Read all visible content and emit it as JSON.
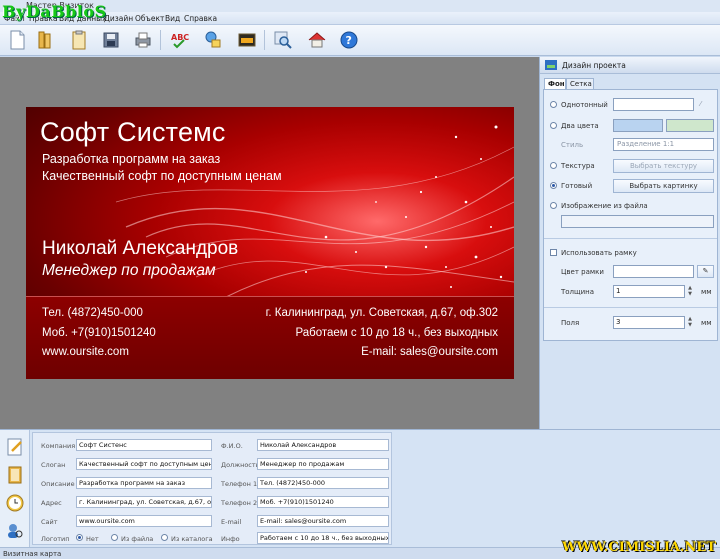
{
  "window": {
    "title": "Мастер Визиток",
    "watermark_top": "ByDaBbloS",
    "watermark_bottom": "WWW.CIMISLIA.NET"
  },
  "menu": [
    "Файл",
    "Правка",
    "Вид данных",
    "Дизайн",
    "Объект",
    "Вид",
    "Справка"
  ],
  "toolbar": {
    "icons": [
      "new-document-icon",
      "open-folder-icon",
      "clipboard-icon",
      "save-disk-icon",
      "print-icon",
      "spellcheck-icon",
      "shapes-icon",
      "image-icon",
      "zoom-icon",
      "home-icon",
      "help-icon"
    ]
  },
  "card": {
    "company": "Софт Системс",
    "slogan": "Разработка программ на заказ",
    "description": "Качественный софт по доступным ценам",
    "name": "Николай Александров",
    "position": "Менеджер по продажам",
    "phone1": "Тел. (4872)450-000",
    "phone2": "Моб. +7(910)1501240",
    "site": "www.oursite.com",
    "address": "г. Калининград, ул. Советская, д.67, оф.302",
    "hours": "Работаем с 10 до 18 ч., без выходных",
    "email": "E-mail: sales@oursite.com",
    "colors": {
      "bright": "#d80e0e",
      "dark": "#6a0000"
    }
  },
  "design_panel": {
    "title": "Дизайн проекта",
    "tabs": [
      "Фон",
      "Сетка"
    ],
    "solid_label": "Однотонный",
    "two_colors_label": "Два цвета",
    "style_label": "Стиль",
    "style_value": "Разделение 1:1",
    "texture_label": "Текстура",
    "choose_texture": "Выбрать текстуру",
    "ready_label": "Готовый",
    "choose_picture": "Выбрать картинку",
    "image_from_file_label": "Изображение из файла",
    "use_frame_label": "Использовать рамку",
    "frame_color_label": "Цвет рамки",
    "thickness_label": "Толщина",
    "thickness_value": "1",
    "thickness_unit": "мм",
    "margins_label": "Поля",
    "margins_value": "3",
    "margins_unit": "мм",
    "two_colors": [
      "#b9d3f0",
      "#cfe7cc"
    ],
    "selected_option": "Готовый"
  },
  "form": {
    "company_label": "Компания",
    "company": "Софт Систенс",
    "slogan_label": "Слоган",
    "slogan": "Качественный софт по доступным ценам",
    "desc_label": "Описание",
    "desc": "Разработка программ на заказ",
    "address_label": "Адрес",
    "address": "г. Калининград, ул. Советская, д.67, оф.302",
    "site_label": "Сайт",
    "site": "www.oursite.com",
    "logo_label": "Логотип",
    "logo_none": "Нет",
    "logo_file": "Из файла",
    "logo_catalog": "Из каталога",
    "fio_label": "Ф.И.О.",
    "fio": "Николай Александров",
    "post_label": "Должность",
    "post": "Менеджер по продажам",
    "phone1_label": "Телефон 1",
    "phone1": "Тел. (4872)450-000",
    "phone2_label": "Телефон 2",
    "phone2": "Моб. +7(910)1501240",
    "email_label": "E-mail",
    "email": "E-mail: sales@oursite.com",
    "info_label": "Инфо",
    "info": "Работаем с 10 до 18 ч., без выходных"
  },
  "status": {
    "text": "Визитная карта"
  }
}
